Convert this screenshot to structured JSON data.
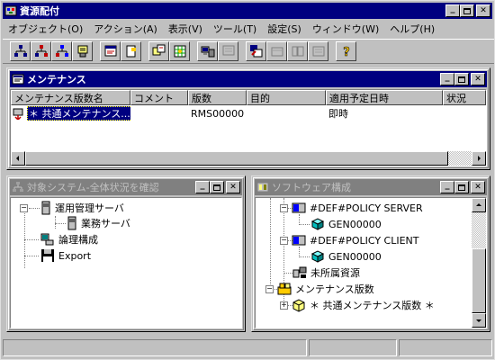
{
  "app": {
    "title": "資源配付",
    "icon": "app-distribution-icon"
  },
  "menubar": {
    "items": [
      {
        "label": "オブジェクト(O)"
      },
      {
        "label": "アクション(A)"
      },
      {
        "label": "表示(V)"
      },
      {
        "label": "ツール(T)"
      },
      {
        "label": "設定(S)"
      },
      {
        "label": "ウィンドウ(W)"
      },
      {
        "label": "ヘルプ(H)"
      }
    ]
  },
  "toolbar": {
    "buttons": [
      "tree-network-icon",
      "tree-network-red-icon",
      "tree-network-blue-icon",
      "server-paper-icon",
      "window-properties-icon",
      "document-flag-icon",
      "copy-objects-icon",
      "settings-grid-icon",
      "computer-transfer-icon",
      "network-disabled-icon",
      "send-to-icon",
      "box-disabled-icon",
      "list-disabled-icon",
      "help-icon"
    ]
  },
  "maintenance_window": {
    "title": "メンテナンス",
    "columns": [
      "メンテナンス版数名",
      "コメント",
      "版数",
      "目的",
      "適用予定日時",
      "状況"
    ],
    "rows": [
      {
        "name": "＊ 共通メンテナンス...",
        "comment": "",
        "version": "RMS00000",
        "purpose": "",
        "schedule": "即時",
        "status": ""
      }
    ]
  },
  "system_window": {
    "title": "対象システム-全体状況を確認",
    "tree": [
      {
        "label": "運用管理サーバ"
      },
      {
        "label": "業務サーバ"
      },
      {
        "label": "論理構成"
      },
      {
        "label": "Export"
      }
    ]
  },
  "software_window": {
    "title": "ソフトウェア構成",
    "tree": [
      {
        "label": "#DEF#POLICY SERVER"
      },
      {
        "label": "GEN00000"
      },
      {
        "label": "#DEF#POLICY CLIENT"
      },
      {
        "label": "GEN00000"
      },
      {
        "label": "未所属資源"
      },
      {
        "label": "メンテナンス版数"
      },
      {
        "label": "＊ 共通メンテナンス版数 ＊"
      }
    ]
  },
  "window_buttons": {
    "minimize": "_",
    "maximize": "□",
    "close": "✕"
  }
}
